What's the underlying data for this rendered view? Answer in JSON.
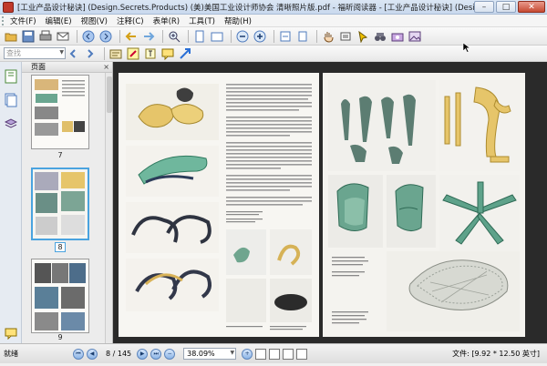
{
  "window": {
    "title": "[工业产品设计秘诀] (Design.Secrets.Products) (美)美国工业设计师协会 清晰照片版.pdf - 福昕阅读器 - [工业产品设计秘诀] (Design.Secrets.Pro...",
    "min_label": "–",
    "max_label": "□",
    "close_label": "✕"
  },
  "menu": {
    "items": [
      "文件(F)",
      "编辑(E)",
      "视图(V)",
      "注释(C)",
      "表单(R)",
      "工具(T)",
      "帮助(H)"
    ]
  },
  "toolbar": {
    "search_placeholder": "查找"
  },
  "thumbnails": {
    "header": "页面",
    "close": "×",
    "pages": [
      {
        "num": "7",
        "selected": false
      },
      {
        "num": "8",
        "selected": true
      },
      {
        "num": "9",
        "selected": false
      }
    ]
  },
  "status": {
    "ready": "就绪",
    "page_info": "8 / 145",
    "zoom": "38.09%",
    "doc_size": "文件: [9.92 * 12.50 英寸]"
  },
  "colors": {
    "titlebar": "#c9d9ee",
    "viewer_bg": "#2a2a2a",
    "selected_thumb": "#4aa3df",
    "green_object": "#5e9a86",
    "yellow_object": "#e8c66a"
  }
}
